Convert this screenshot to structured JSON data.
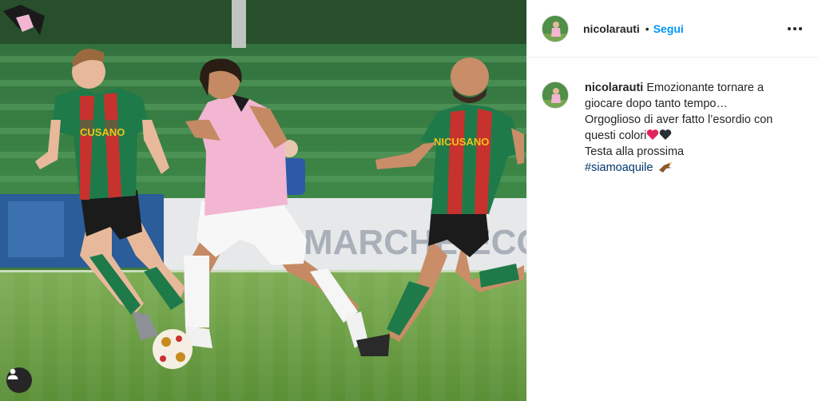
{
  "post": {
    "username": "nicolarauti",
    "separator": "•",
    "follow_label": "Segui",
    "more_options_icon": "more-horizontal-icon",
    "tag_icon": "user-tag-icon",
    "caption": {
      "line1": "Emozionante tornare a",
      "line2": "giocare dopo tanto tempo…",
      "line3": "Orgoglioso di aver fatto l’esordio con",
      "line4": "questi colori",
      "line5": "Testa alla prossima",
      "hashtag": "#siamoaquile",
      "emojis": [
        "red-heart-icon",
        "black-heart-icon",
        "eagle-icon"
      ]
    },
    "photo": {
      "shirt_sponsor_left": "CUSANO",
      "shirt_sponsor_right": "NICUSANO",
      "ad_board_text": "MARCHE ECCELLENZA",
      "colors": {
        "ternana_green": "#1f7a4a",
        "ternana_red": "#c8322e",
        "palermo_pink": "#f2b6d2",
        "pitch": "#5d9a3e"
      }
    }
  }
}
